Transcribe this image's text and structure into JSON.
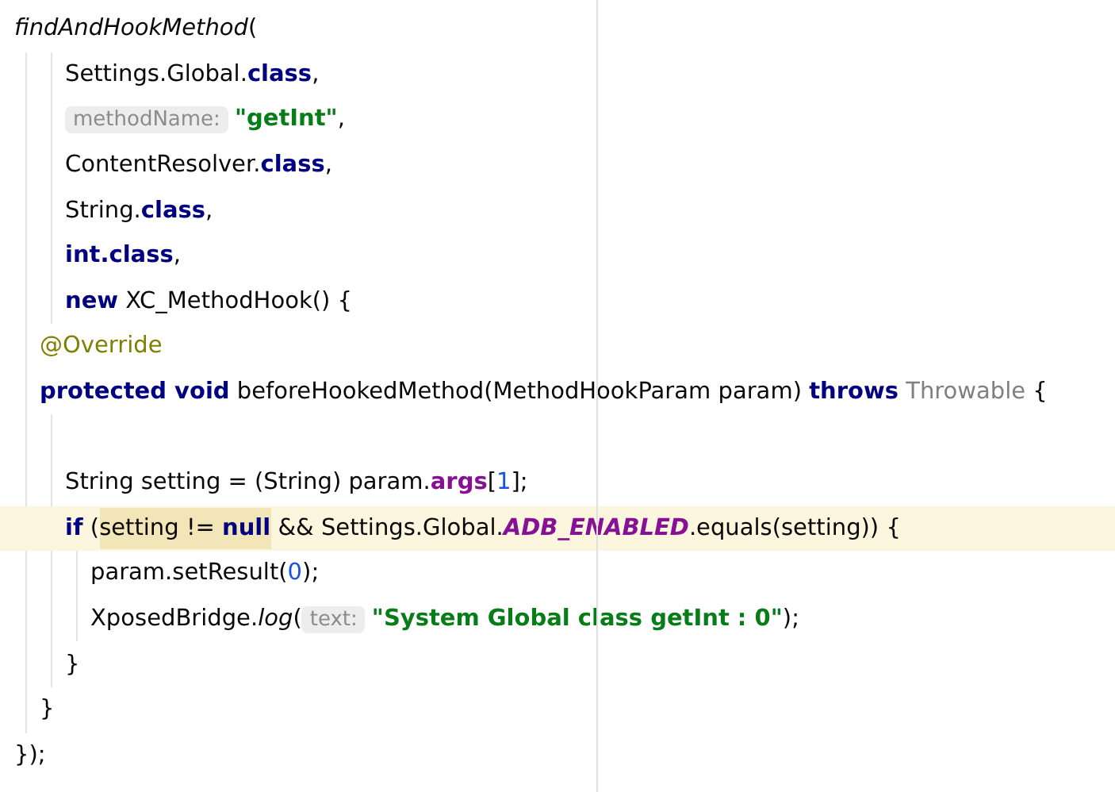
{
  "editor": {
    "lines": [
      {
        "kind": "code",
        "highlighted": false,
        "tokens": [
          {
            "text": "findAndHookMethod",
            "kind": "static-method"
          },
          {
            "text": "(",
            "kind": "plain"
          }
        ],
        "children": [
          {
            "kind": "group",
            "children": [
              {
                "kind": "code",
                "highlighted": false,
                "tokens": [
                  {
                    "text": "Settings.Global.",
                    "kind": "plain"
                  },
                  {
                    "text": "class",
                    "kind": "keyword"
                  },
                  {
                    "text": ",",
                    "kind": "plain"
                  }
                ]
              },
              {
                "kind": "code",
                "highlighted": false,
                "tokens": [
                  {
                    "text": "methodName:",
                    "kind": "hint"
                  },
                  {
                    "text": "\"getInt\"",
                    "kind": "string"
                  },
                  {
                    "text": ",",
                    "kind": "plain"
                  }
                ]
              },
              {
                "kind": "code",
                "highlighted": false,
                "tokens": [
                  {
                    "text": "ContentResolver.",
                    "kind": "plain"
                  },
                  {
                    "text": "class",
                    "kind": "keyword"
                  },
                  {
                    "text": ",",
                    "kind": "plain"
                  }
                ]
              },
              {
                "kind": "code",
                "highlighted": false,
                "tokens": [
                  {
                    "text": "String.",
                    "kind": "plain"
                  },
                  {
                    "text": "class",
                    "kind": "keyword"
                  },
                  {
                    "text": ",",
                    "kind": "plain"
                  }
                ]
              },
              {
                "kind": "code",
                "highlighted": false,
                "tokens": [
                  {
                    "text": "int.class",
                    "kind": "keyword"
                  },
                  {
                    "text": ",",
                    "kind": "plain"
                  }
                ]
              },
              {
                "kind": "code",
                "highlighted": false,
                "tokens": [
                  {
                    "text": "new",
                    "kind": "keyword"
                  },
                  {
                    "text": " XC_MethodHook() {",
                    "kind": "plain"
                  }
                ]
              }
            ]
          },
          {
            "kind": "code",
            "highlighted": false,
            "tokens": [
              {
                "text": "@Override",
                "kind": "annotation"
              }
            ]
          },
          {
            "kind": "code",
            "highlighted": false,
            "tokens": [
              {
                "text": "protected void",
                "kind": "keyword"
              },
              {
                "text": " beforeHookedMethod(MethodHookParam param) ",
                "kind": "plain"
              },
              {
                "text": "throws",
                "kind": "keyword"
              },
              {
                "text": " Throwable",
                "kind": "unused"
              },
              {
                "text": " {",
                "kind": "plain"
              }
            ],
            "children": [
              {
                "kind": "blank"
              },
              {
                "kind": "code",
                "highlighted": false,
                "tokens": [
                  {
                    "text": "String setting = (String) param.",
                    "kind": "plain"
                  },
                  {
                    "text": "args",
                    "kind": "field"
                  },
                  {
                    "text": "[",
                    "kind": "plain"
                  },
                  {
                    "text": "1",
                    "kind": "number"
                  },
                  {
                    "text": "];",
                    "kind": "plain"
                  }
                ]
              },
              {
                "kind": "code",
                "highlighted": true,
                "tokens": [
                  {
                    "text": "if",
                    "kind": "keyword"
                  },
                  {
                    "text": " (",
                    "kind": "plain"
                  },
                  {
                    "text": "setting != ",
                    "kind": "plain",
                    "marked": true
                  },
                  {
                    "text": "null",
                    "kind": "keyword",
                    "marked": true
                  },
                  {
                    "text": " && Settings.Global.",
                    "kind": "plain"
                  },
                  {
                    "text": "ADB_ENABLED",
                    "kind": "static-field"
                  },
                  {
                    "text": ".equals(setting)) {",
                    "kind": "plain"
                  }
                ],
                "children": [
                  {
                    "kind": "code",
                    "highlighted": false,
                    "tokens": [
                      {
                        "text": "param.setResult(",
                        "kind": "plain"
                      },
                      {
                        "text": "0",
                        "kind": "number"
                      },
                      {
                        "text": ");",
                        "kind": "plain"
                      }
                    ]
                  },
                  {
                    "kind": "code",
                    "highlighted": false,
                    "tokens": [
                      {
                        "text": "XposedBridge.",
                        "kind": "plain"
                      },
                      {
                        "text": "log",
                        "kind": "static-method"
                      },
                      {
                        "text": "(",
                        "kind": "plain"
                      },
                      {
                        "text": "text:",
                        "kind": "hint"
                      },
                      {
                        "text": "\"System Global class getInt : 0\"",
                        "kind": "string"
                      },
                      {
                        "text": ");",
                        "kind": "plain"
                      }
                    ]
                  }
                ]
              },
              {
                "kind": "code",
                "highlighted": false,
                "tokens": [
                  {
                    "text": "}",
                    "kind": "plain"
                  }
                ]
              }
            ]
          },
          {
            "kind": "code",
            "highlighted": false,
            "tokens": [
              {
                "text": "}",
                "kind": "plain"
              }
            ]
          }
        ]
      },
      {
        "kind": "code",
        "highlighted": false,
        "tokens": [
          {
            "text": "});",
            "kind": "plain"
          }
        ]
      }
    ]
  }
}
